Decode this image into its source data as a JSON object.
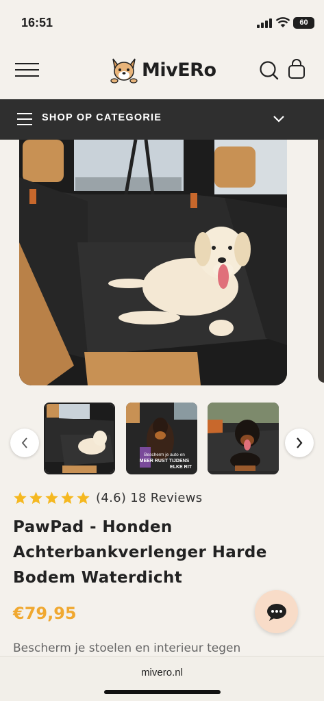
{
  "status_bar": {
    "time": "16:51",
    "battery": "60"
  },
  "header": {
    "logo_text": "MivERo"
  },
  "category_bar": {
    "label": "SHOP OP CATEGORIE"
  },
  "gallery": {
    "thumbnail_2_caption_line1": "Bescherm je auto en",
    "thumbnail_2_caption_line2": "MEER RUST TIJDENS",
    "thumbnail_2_caption_line3": "ELKE RIT"
  },
  "product": {
    "rating_value": 4.6,
    "rating_text": "(4.6) 18 Reviews",
    "stars": 5,
    "title": "PawPad - Honden Achterbankverlenger Harde Bodem Waterdicht",
    "price": "€79,95",
    "description_preview": "Bescherm je stoelen en interieur tegen"
  },
  "browser": {
    "url": "mivero.nl"
  },
  "colors": {
    "accent": "#f0a830",
    "star": "#f5b820",
    "catbar": "#2f2f2f"
  }
}
